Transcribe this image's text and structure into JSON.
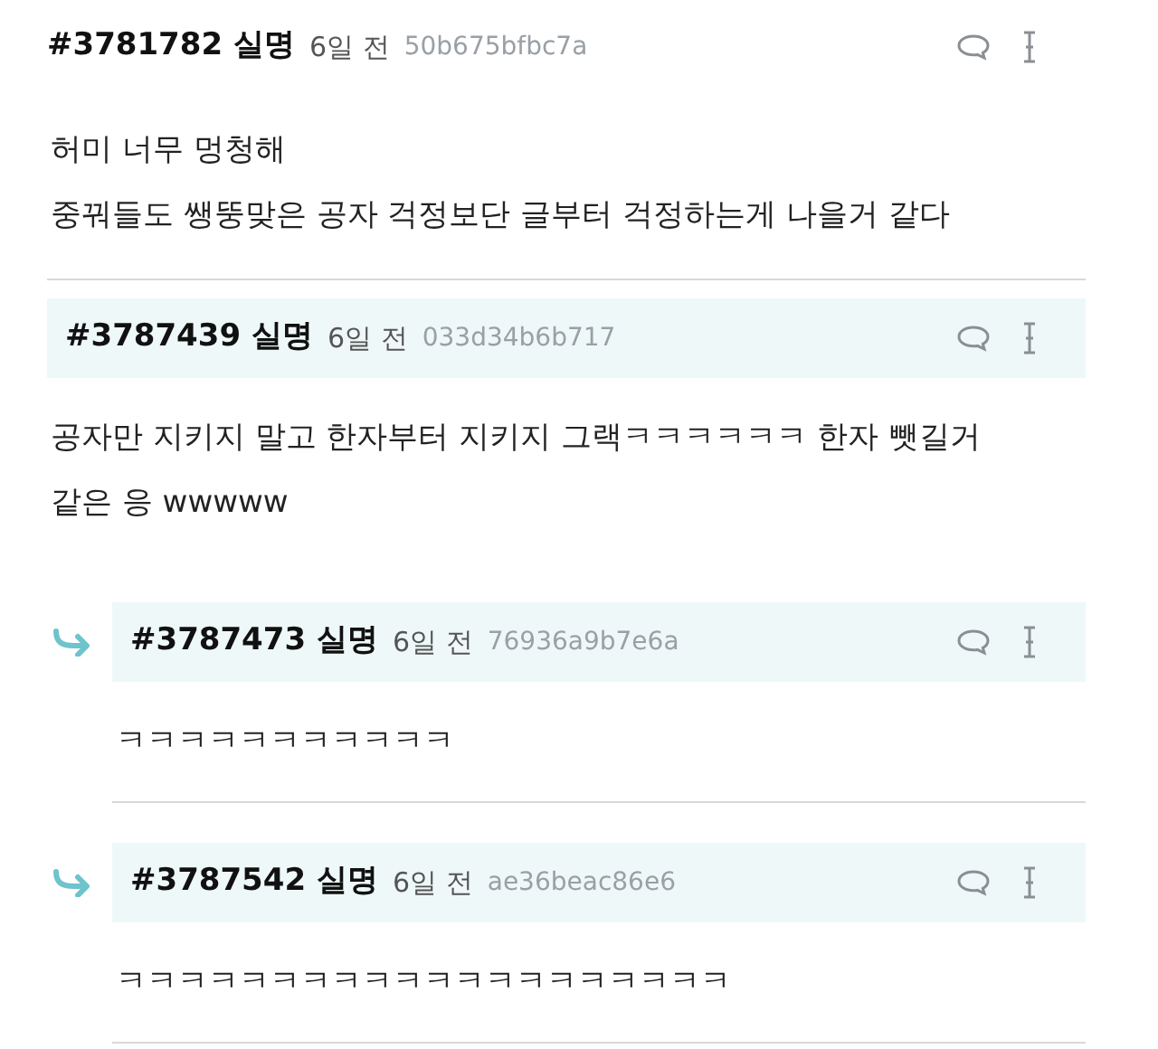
{
  "comments": [
    {
      "kind": "post",
      "number": "#3781782",
      "author": "실명",
      "time": "6일 전",
      "hash": "50b675bfbc7a",
      "lines": [
        "허미 너무 멍청해",
        "중꿔들도 쌩뚱맞은 공자 걱정보단 글부터 걱정하는게 나을거 같다"
      ]
    },
    {
      "kind": "comment",
      "number": "#3787439",
      "author": "실명",
      "time": "6일 전",
      "hash": "033d34b6b717",
      "lines": [
        "공자만 지키지 말고 한자부터 지키지 그랙ㅋㅋㅋㅋㅋㅋ 한자 뺏길거",
        "같은 응 wwwww"
      ]
    },
    {
      "kind": "reply",
      "number": "#3787473",
      "author": "실명",
      "time": "6일 전",
      "hash": "76936a9b7e6a",
      "lines": [
        "ㅋㅋㅋㅋㅋㅋㅋㅋㅋㅋㅋ"
      ]
    },
    {
      "kind": "reply",
      "number": "#3787542",
      "author": "실명",
      "time": "6일 전",
      "hash": "ae36beac86e6",
      "lines": [
        "ㅋㅋㅋㅋㅋㅋㅋㅋㅋㅋㅋㅋㅋㅋㅋㅋㅋㅋㅋㅋ"
      ]
    }
  ]
}
